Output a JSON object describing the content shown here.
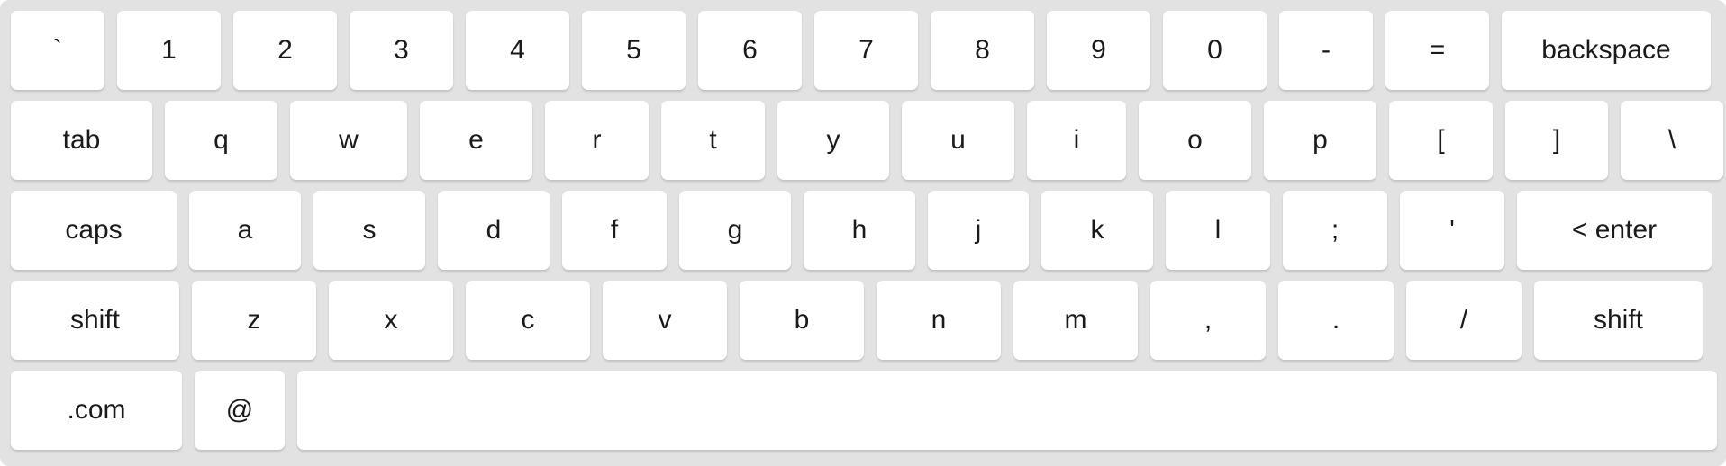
{
  "keyboard": {
    "row1": [
      "`",
      "1",
      "2",
      "3",
      "4",
      "5",
      "6",
      "7",
      "8",
      "9",
      "0",
      "-",
      "=",
      "backspace"
    ],
    "row2": [
      "tab",
      "q",
      "w",
      "e",
      "r",
      "t",
      "y",
      "u",
      "i",
      "o",
      "p",
      "[",
      "]",
      "\\"
    ],
    "row3": [
      "caps",
      "a",
      "s",
      "d",
      "f",
      "g",
      "h",
      "j",
      "k",
      "l",
      ";",
      "'",
      "< enter"
    ],
    "row4": [
      "shift",
      "z",
      "x",
      "c",
      "v",
      "b",
      "n",
      "m",
      ",",
      ".",
      "/",
      "shift"
    ],
    "row5": [
      ".com",
      "@",
      ""
    ]
  }
}
